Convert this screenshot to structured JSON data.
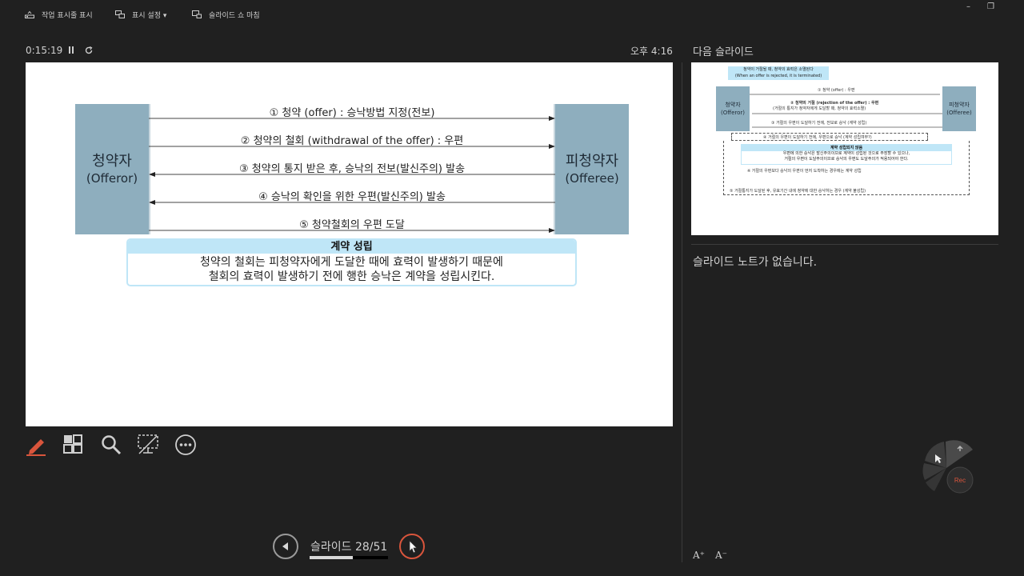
{
  "toolbar": {
    "taskbar_label": "작업 표시줄 표시",
    "display_settings_label": "표시 설정 ▾",
    "end_show_label": "슬라이드 쇼 마침",
    "minimize": "–",
    "restore": "❐"
  },
  "status": {
    "timer": "0:15:19",
    "clock": "오후 4:16"
  },
  "slide": {
    "offeror_ko": "청약자",
    "offeror_en": "(Offeror)",
    "offeree_ko": "피청약자",
    "offeree_en": "(Offeree)",
    "steps": [
      "① 청약 (offer) : 승낙방법 지정(전보)",
      "② 청약의 철회 (withdrawal of the offer) : 우편",
      "③ 청약의 통지 받은 후, 승낙의 전보(발신주의) 발송",
      "④ 승낙의 확인을 위한 우편(발신주의) 발송",
      "⑤ 청약철회의 우편 도달"
    ],
    "contract_title": "계약 성립",
    "contract_line1": "청약의 철회는 피청약자에게 도달한 때에 효력이 발생하기 때문에",
    "contract_line2": "철회의 효력이 발생하기 전에 행한 승낙은 계약을 성립시킨다."
  },
  "navigation": {
    "slide_counter": "슬라이드 28/51",
    "progress_percent": 55
  },
  "next_pane": {
    "title": "다음 슬라이드",
    "thumb": {
      "banner_line1": "청약이 거절될 때, 청약의 효력은 소멸된다",
      "banner_line2": "(When an offer is rejected, it is terminated)",
      "offeror_ko": "청약자",
      "offeror_en": "(Offeror)",
      "offeree_ko": "피청약자",
      "offeree_en": "(Offeree)",
      "step1": "① 청약 (offer) : 우편",
      "step2": "② 청약의 거절 (rejection of the offer) : 우편",
      "step2_note": "(거절의 통지가 청약자에게 도달할 때, 청약의 효력소멸)",
      "step3": "③ 거절의 우편이 도달하기 전에, 전보로 승낙 (계약 성립)",
      "step4": "④ 거절의 우편이 도달하기 전에, 우편으로 승낙 (계약 성립여부?)",
      "box_title": "계약 성립되지 않음",
      "box_line1": "우편에 의한 승낙은 발신주의이므로 계약이 성립된 것으로 주장할 수 있으나,",
      "box_line2": "거절의 우편이 도달주의이므로 승낙의 우편도 도달주의가 적용되어야 한다.",
      "note": "※ 거절의 우편보다 승낙의 우편이 먼저 도착하는 경우에는 계약 성립",
      "step5": "⑤ 거절통지가 도달된 후, 유효기간 내에 청약에 대한 승낙하는 경우 (계약 불성립)"
    }
  },
  "notes": {
    "text": "슬라이드 노트가 없습니다."
  },
  "font_controls": {
    "increase": "A⁺",
    "decrease": "A⁻"
  },
  "rec": {
    "label": "Rec"
  },
  "colors": {
    "background": "#202020",
    "party_box": "#8eaebe",
    "contract_header": "#bfe6f7",
    "accent_red": "#d9553c"
  }
}
